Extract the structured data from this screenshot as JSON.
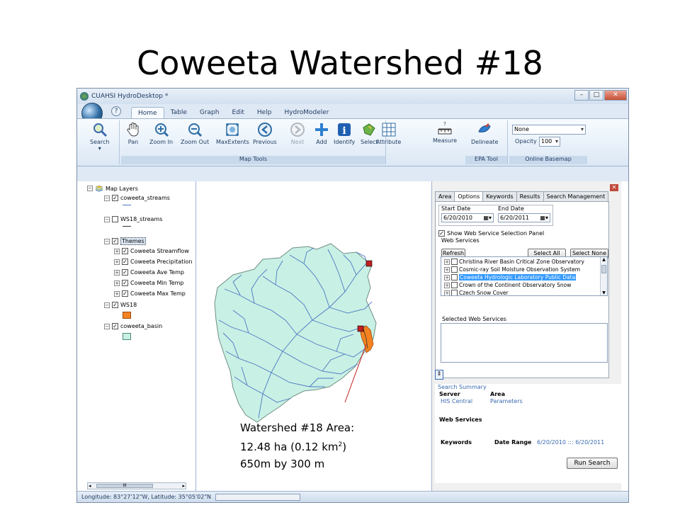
{
  "slide": {
    "title": "Coweeta Watershed #18"
  },
  "window": {
    "title": "CUAHSI HydroDesktop *",
    "controls": [
      "–",
      "□",
      "✕"
    ]
  },
  "menu": {
    "tabs": [
      "Home",
      "Table",
      "Graph",
      "Edit",
      "Help",
      "HydroModeler"
    ],
    "active_tab": "Home"
  },
  "ribbon": {
    "search": "Search",
    "map_tools": [
      "Pan",
      "Zoom In",
      "Zoom Out",
      "MaxExtents",
      "Previous",
      "Next",
      "Add",
      "Identify",
      "Select",
      "Attribute",
      "Measure"
    ],
    "map_tools_label": "Map Tools",
    "epa_tool_button": "Delineate",
    "epa_tool_label": "EPA Tool",
    "basemap_value": "None",
    "opacity_label": "Opacity",
    "opacity_value": "100",
    "online_basemap_label": "Online Basemap"
  },
  "legend": {
    "root": "Map Layers",
    "layers": [
      {
        "name": "coweeta_streams"
      },
      {
        "name": "WS18_streams"
      },
      {
        "name": "Themes"
      },
      {
        "name": "Coweeta Streamflow"
      },
      {
        "name": "Coweeta Precipitation"
      },
      {
        "name": "Coweeta Ave Temp"
      },
      {
        "name": "Coweeta Min Temp"
      },
      {
        "name": "Coweeta Max Temp"
      },
      {
        "name": "WS18"
      },
      {
        "name": "coweeta_basin"
      }
    ],
    "colors": {
      "ws18": "#f58220",
      "basin": "#c9f0e4",
      "streams": "#4a78c4"
    }
  },
  "search_panel": {
    "tabs": [
      "Area",
      "Options",
      "Keywords",
      "Results",
      "Search Management"
    ],
    "active_tab": "Options",
    "start_date_label": "Start Date",
    "start_date": "6/20/2010",
    "end_date_label": "End Date",
    "end_date": "6/20/2011",
    "show_panel_label": "Show Web Service Selection Panel",
    "web_services_label": "Web Services",
    "refresh": "Refresh",
    "select_all": "Select All",
    "select_none": "Select None",
    "services": [
      "Christina River Basin Critical Zone Observatory",
      "Cosmic-ray Soil Moisture Observation System",
      "Coweeta Hydrologic Laboratory Public Data",
      "Crown of the Continent Observatory Snow",
      "Czech Snow Cover"
    ],
    "selected_services_label": "Selected Web Services"
  },
  "summary": {
    "title": "Search Summary",
    "server_label": "Server",
    "server_value": "HIS Central",
    "area_label": "Area",
    "area_value": "Parameters",
    "web_services_label": "Web Services",
    "keywords_label": "Keywords",
    "date_range_label": "Date Range",
    "date_range_value": "6/20/2010 ::: 6/20/2011",
    "run_search": "Run Search"
  },
  "status": {
    "coords": "Longitude: 83°27'12\"W, Latitude: 35°05'02\"N"
  },
  "annotation": {
    "line1": "Watershed #18 Area:",
    "line2_a": "12.48 ha (0.12 km",
    "line2_sup": "2",
    "line2_b": ")",
    "line3": "650m by 300 m"
  }
}
